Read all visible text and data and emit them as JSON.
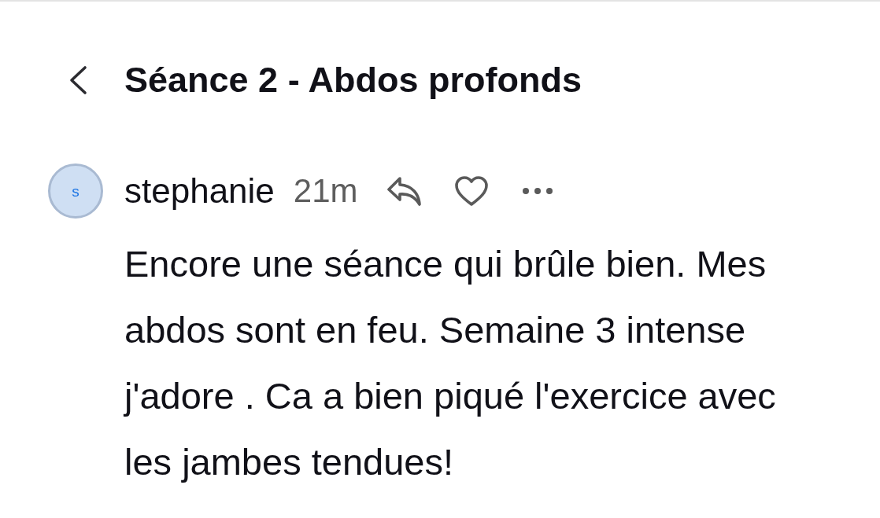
{
  "header": {
    "title": "Séance 2 - Abdos profonds"
  },
  "comments": [
    {
      "avatar_initial": "s",
      "author": "stephanie",
      "time": "21m",
      "liked": false,
      "text": "Encore une séance qui brûle bien. Mes abdos sont en feu. Semaine 3 intense j'adore . Ca a bien piqué l'exercice avec les jambes tendues!"
    }
  ]
}
